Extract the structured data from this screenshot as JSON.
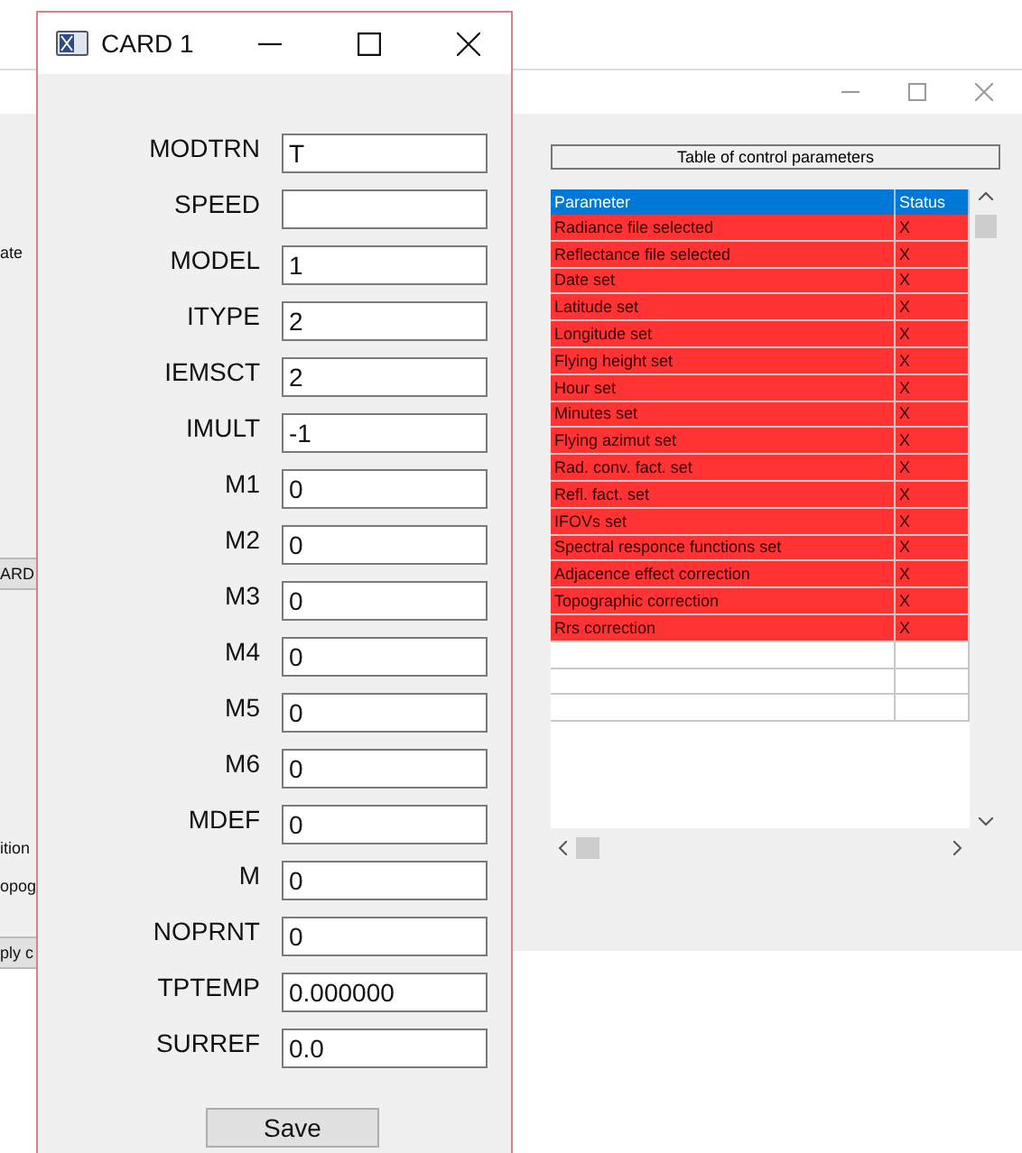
{
  "background_window": {
    "fragments": [
      {
        "text": "ate",
        "kind": "label"
      },
      {
        "text": "ARD",
        "kind": "button"
      },
      {
        "text": "ition",
        "kind": "label"
      },
      {
        "text": "opog",
        "kind": "label"
      },
      {
        "text": "ply c",
        "kind": "button"
      }
    ],
    "table_title": "Table of control parameters",
    "table": {
      "columns": [
        "Parameter",
        "Status"
      ],
      "rows": [
        {
          "parameter": "Radiance file selected",
          "status": "X"
        },
        {
          "parameter": "Reflectance file selected",
          "status": "X"
        },
        {
          "parameter": "Date set",
          "status": "X"
        },
        {
          "parameter": "Latitude set",
          "status": "X"
        },
        {
          "parameter": "Longitude set",
          "status": "X"
        },
        {
          "parameter": "Flying height set",
          "status": "X"
        },
        {
          "parameter": "Hour set",
          "status": "X"
        },
        {
          "parameter": "Minutes set",
          "status": "X"
        },
        {
          "parameter": "Flying azimut set",
          "status": "X"
        },
        {
          "parameter": "Rad. conv. fact. set",
          "status": "X"
        },
        {
          "parameter": "Refl. fact. set",
          "status": "X"
        },
        {
          "parameter": "IFOVs set",
          "status": "X"
        },
        {
          "parameter": "Spectral responce functions set",
          "status": "X"
        },
        {
          "parameter": "Adjacence effect correction",
          "status": "X"
        },
        {
          "parameter": "Topographic correction",
          "status": "X"
        },
        {
          "parameter": "Rrs correction",
          "status": "X"
        }
      ]
    }
  },
  "card_window": {
    "title": "CARD 1",
    "fields": [
      {
        "label": "MODTRN",
        "value": "T"
      },
      {
        "label": "SPEED"
      },
      {
        "label": "MODEL",
        "value": "1"
      },
      {
        "label": "ITYPE",
        "value": "2"
      },
      {
        "label": "IEMSCT",
        "value": "2"
      },
      {
        "label": "IMULT",
        "value": "-1"
      },
      {
        "label": "M1",
        "value": "0"
      },
      {
        "label": "M2",
        "value": "0"
      },
      {
        "label": "M3",
        "value": "0"
      },
      {
        "label": "M4",
        "value": "0"
      },
      {
        "label": "M5",
        "value": "0"
      },
      {
        "label": "M6",
        "value": "0"
      },
      {
        "label": "MDEF",
        "value": "0"
      },
      {
        "label": "M",
        "value": "0"
      },
      {
        "label": "NOPRNT",
        "value": "0"
      },
      {
        "label": "TPTEMP",
        "value": "0.000000"
      },
      {
        "label": "SURREF",
        "value": "0.0"
      }
    ],
    "save_button": "Save"
  }
}
